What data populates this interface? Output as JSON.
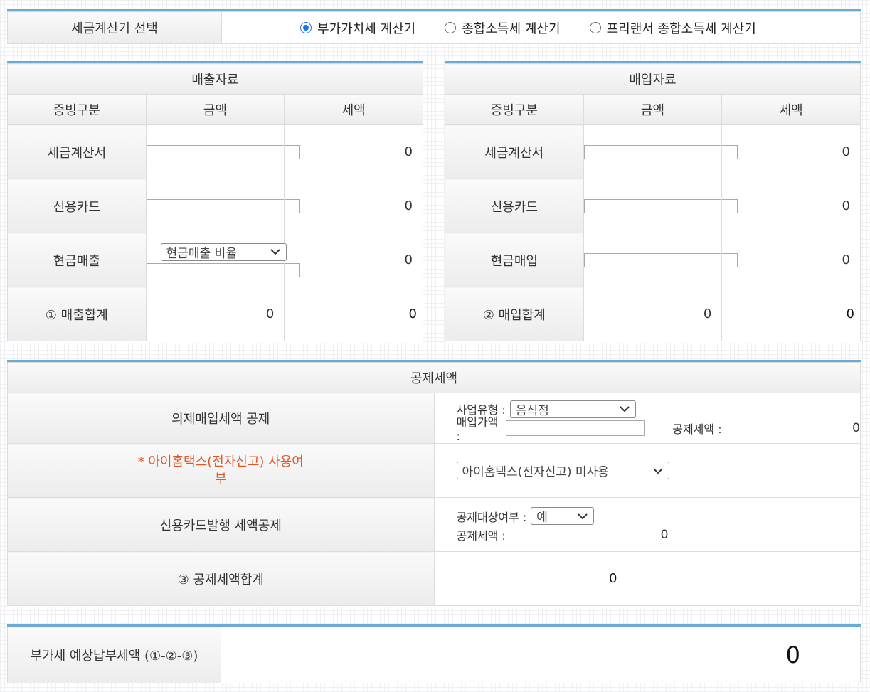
{
  "selector": {
    "label": "세금계산기 선택",
    "options": [
      "부가가치세 계산기",
      "종합소득세 계산기",
      "프리랜서 종합소득세 계산기"
    ]
  },
  "sales": {
    "title": "매출자료",
    "col_type": "증빙구분",
    "col_amount": "금액",
    "col_tax": "세액",
    "rows": [
      {
        "label": "세금계산서",
        "tax": "0"
      },
      {
        "label": "신용카드",
        "tax": "0"
      },
      {
        "label": "현금매출",
        "select": "현금매출 비율",
        "tax": "0"
      }
    ],
    "total": {
      "label": "① 매출합계",
      "amount": "0",
      "tax": "0"
    }
  },
  "purchase": {
    "title": "매입자료",
    "col_type": "증빙구분",
    "col_amount": "금액",
    "col_tax": "세액",
    "rows": [
      {
        "label": "세금계산서",
        "tax": "0"
      },
      {
        "label": "신용카드",
        "tax": "0"
      },
      {
        "label": "현금매입",
        "tax": "0"
      }
    ],
    "total": {
      "label": "② 매입합계",
      "amount": "0",
      "tax": "0"
    }
  },
  "deduction": {
    "title": "공제세액",
    "deemed": {
      "label": "의제매입세액 공제",
      "biz_type_label": "사업유형 :",
      "biz_type_value": "음식점",
      "purchase_price_label": "매입가액 :",
      "deduct_label": "공제세액 :",
      "deduct_value": "0"
    },
    "hometax": {
      "label_line1": "* 아이홈택스(전자신고) 사용여",
      "label_line2": "부",
      "select": "아이홈택스(전자신고) 미사용"
    },
    "card": {
      "label": "신용카드발행 세액공제",
      "target_label": "공제대상여부 :",
      "target_value": "예",
      "deduct_label": "공제세액 :",
      "deduct_value": "0"
    },
    "total": {
      "label": "③ 공제세액합계",
      "value": "0"
    }
  },
  "result": {
    "label": "부가세 예상납부세액 (①-②-③)",
    "value": "0"
  },
  "colors": {
    "accent_line": "#6aaad4",
    "warning_text": "#e0582a",
    "radio_selected": "#1a73e8"
  }
}
